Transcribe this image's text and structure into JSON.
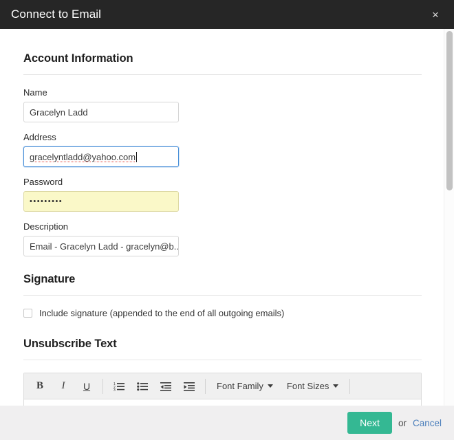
{
  "titlebar": {
    "title": "Connect to Email",
    "close_label": "×"
  },
  "sections": {
    "account": {
      "heading": "Account Information",
      "fields": {
        "name": {
          "label": "Name",
          "value": "Gracelyn Ladd"
        },
        "address": {
          "label": "Address",
          "value": "gracelyntladd@yahoo.com"
        },
        "password": {
          "label": "Password",
          "value": "•••••••••"
        },
        "description": {
          "label": "Description",
          "value": "Email - Gracelyn Ladd - gracelyn@b..."
        }
      }
    },
    "signature": {
      "heading": "Signature",
      "checkbox_label": "Include signature (appended to the end of all outgoing emails)",
      "checked": false
    },
    "unsubscribe": {
      "heading": "Unsubscribe Text",
      "toolbar": {
        "bold": "B",
        "italic": "I",
        "underline": "U",
        "ordered_list": "ordered-list",
        "bullet_list": "bullet-list",
        "outdent": "outdent",
        "indent": "indent",
        "font_family": "Font Family",
        "font_sizes": "Font Sizes"
      }
    }
  },
  "footer": {
    "next_label": "Next",
    "or_label": "or",
    "cancel_label": "Cancel"
  },
  "colors": {
    "titlebar_bg": "#262626",
    "accent_green": "#34b893",
    "link_blue": "#4a7ebb",
    "focus_blue": "#4a90d9",
    "autofill_yellow": "#faf8c8",
    "footer_bg": "#f0eff0"
  }
}
